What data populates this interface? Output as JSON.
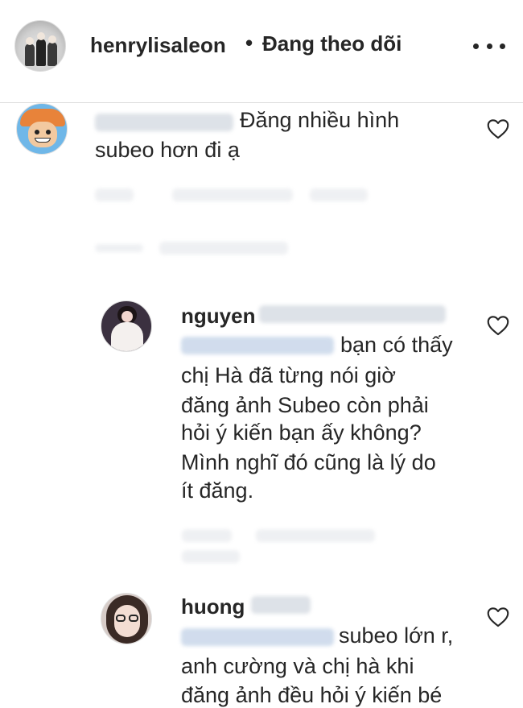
{
  "header": {
    "username": "henrylisaleon",
    "separator": "•",
    "follow_status": "Đang theo dõi",
    "more_icon": "more-horizontal-icon"
  },
  "comments": [
    {
      "username": "",
      "text_lines": [
        "Đăng nhiều hình",
        "subeo hơn đi ạ"
      ],
      "avatar": "cartoon-avatar",
      "like_icon": "heart-outline-icon"
    },
    {
      "username": "nguyen",
      "mention": "",
      "text_lines": [
        "bạn có thấy",
        "chị Hà đã từng nói giờ",
        "đăng ảnh Subeo còn phải",
        "hỏi ý kiến bạn ấy không?",
        "Mình nghĩ đó cũng là lý do",
        "ít đăng."
      ],
      "avatar": "girl-avatar",
      "like_icon": "heart-outline-icon"
    },
    {
      "username": "huong",
      "mention": "",
      "text_lines": [
        "subeo lớn r,",
        "anh cường và chị hà khi",
        "đăng ảnh đều hỏi ý kiến bé"
      ],
      "avatar": "girl-glasses-avatar",
      "like_icon": "heart-outline-icon"
    }
  ]
}
